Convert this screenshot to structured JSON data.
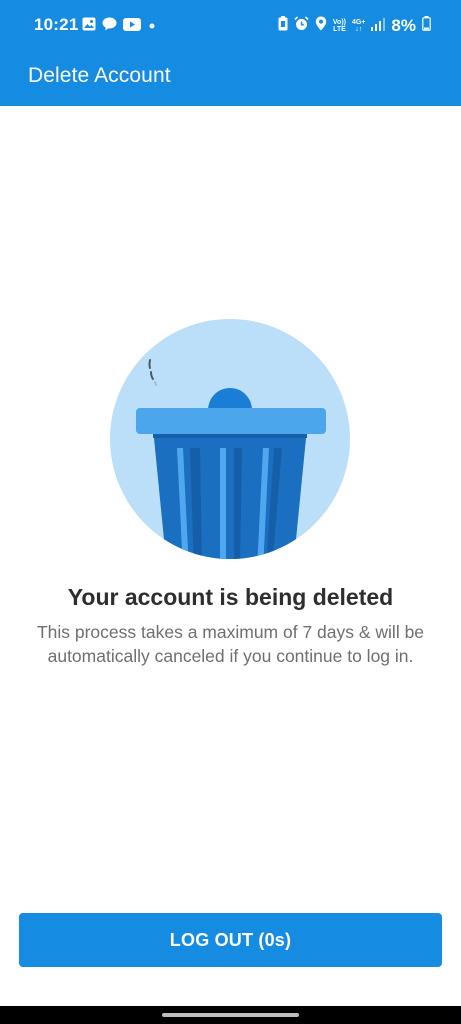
{
  "status_bar": {
    "time": "10:21",
    "battery_percent": "8%",
    "network_volte": "Vo))",
    "network_lte": "LTE",
    "network_4g": "4G+",
    "left_icons": [
      "gallery-icon",
      "chat-bubble-icon",
      "youtube-icon",
      "dot-icon"
    ],
    "right_icons": [
      "battery-saver-icon",
      "alarm-icon",
      "location-icon",
      "signal-icon",
      "battery-icon"
    ]
  },
  "app_bar": {
    "title": "Delete Account"
  },
  "main": {
    "title": "Your account is being deleted",
    "description": "This process takes a maximum of 7 days & will be automatically canceled if you continue to log in."
  },
  "button": {
    "label": "LOG OUT (0s)"
  },
  "colors": {
    "primary": "#158be2",
    "illustration_circle": "#bbdff8",
    "bin_body": "#1a6fc1",
    "bin_lid": "#4ba6ec",
    "title_text": "#2e2e2e",
    "description_text": "#6f6f6f"
  }
}
